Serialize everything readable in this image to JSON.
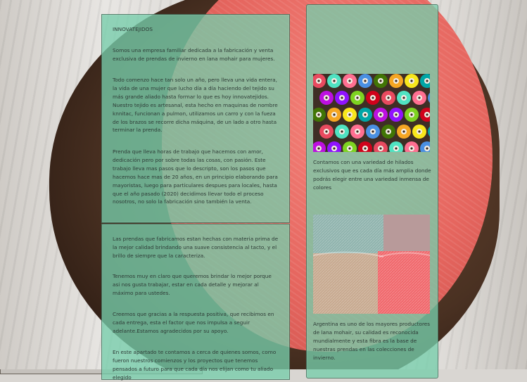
{
  "about": {
    "title": "INNOVATEJIDOS",
    "paragraphs": [
      "Somos una empresa familiar dedicada a la fabricación y venta exclusiva de prendas de invierno en lana mohair para mujeres.",
      "Todo comenzo hace tan solo un año, pero lleva una vida entera, la vida de una mujer que lucho día a día haciendo del tejido su más grande aliado hasta formar lo que es hoy innovatejidos. Nuestro tejido es artesanal, esta hecho en maquinas de nombre knnitac, funcionan a pulmon, utilizamos un carro y con la fueza de los brazos se recorre dicha máquina, de un lado a otro hasta terminar la prenda.",
      "Prenda que lleva horas de trabajo que hacemos con amor, dedicación pero por sobre todas las cosas, con pasión. Este trabajo lleva mas pasos que lo descripto, son los pasos que hacemos hace mas de 20 años, en un principio elaborando para mayoristas, luego para particulares despues para locales, hasta que el año pasado (2020) decidimos llevar todo el proceso nosotros, no solo la fabricación sino también la venta."
    ]
  },
  "quality": {
    "paragraphs": [
      "Las prendas que fabricamos estan hechas con materia prima de la mejor calidad brindando una suave consistencia al tacto, y el brillo de siempre que la caracteriza.",
      "Tenemos muy en claro que queremos brindar lo mejor porque asi nos gusta trabajar, estar en cada detalle y mejorar al máximo para ustedes.",
      "Creemos que gracias a la respuesta positiva, que recibimos en cada entrega, esta el factor que nos impulsa a seguir adelante.Estamos agradecidos por su apoyo.",
      "En este apartado te contamos a cerca de quienes somos, como fueron nuestros comienzos y los proyectos que tenemos pensados a futuro para que cada día nos elijan como tu aliado elegido"
    ]
  },
  "products": {
    "items": [
      {
        "image_icon": "yarn-spools-image",
        "caption": "Contamos con una variedad de hilados exclusivos que es cada día más amplia donde podrás elegir entre una variedad inmensa de colores"
      },
      {
        "image_icon": "mohair-skeins-image",
        "caption": "Argentina es uno de los mayores productores de lana mohair, su calidad es reconocida mundialmente y esta fibra es la base de nuestras prendas en las colecciones de invierno."
      }
    ]
  },
  "colors": {
    "panel": "#76cdaa",
    "text": "#2d3b36",
    "yarn": "#e5655e",
    "bark": "#4a3122"
  }
}
